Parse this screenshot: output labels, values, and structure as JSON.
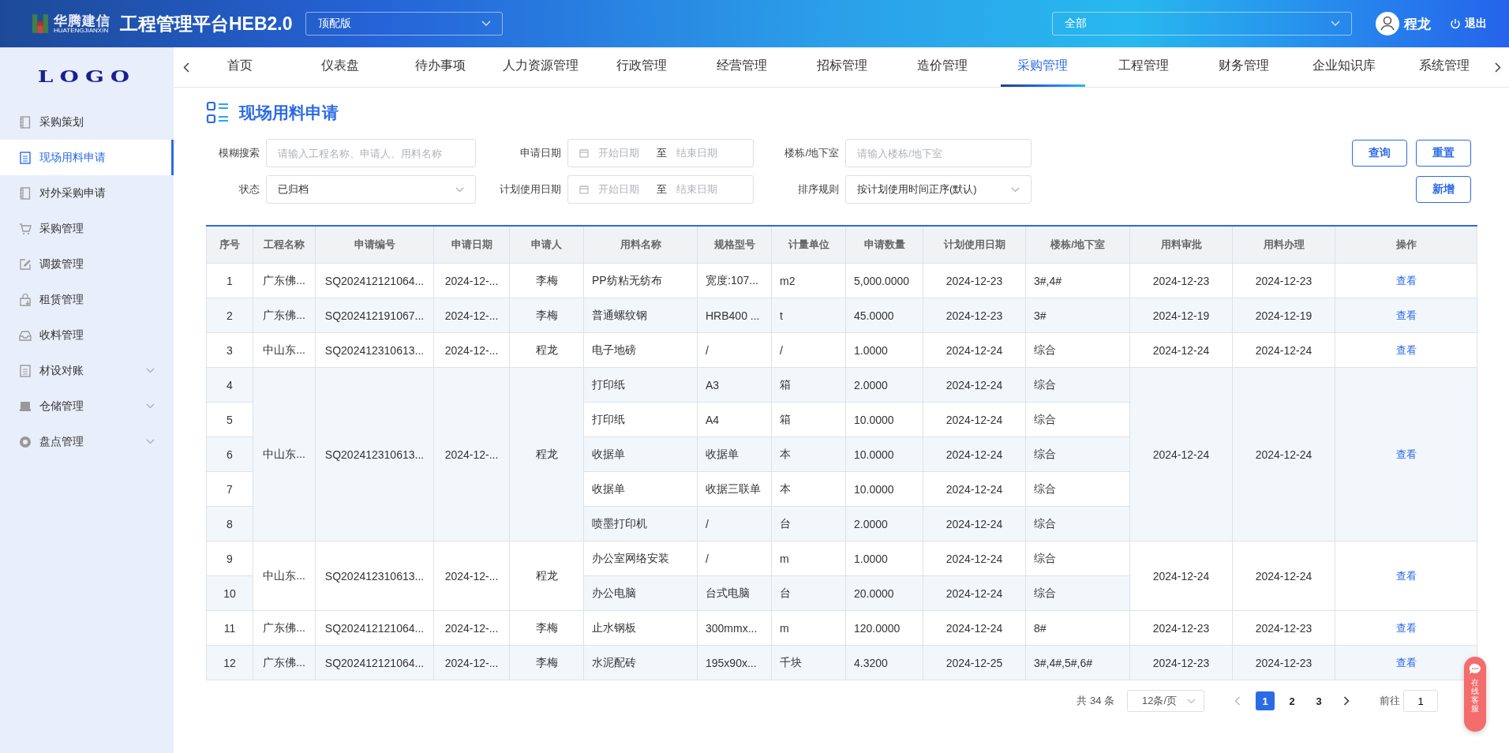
{
  "header": {
    "brand": {
      "name": "华腾建信",
      "latin": "HUATENGJIANXIN"
    },
    "title": "工程管理平台HEB2.0",
    "edition_select": {
      "value": "顶配版"
    },
    "scope_select": {
      "value": "全部"
    },
    "user": {
      "name": "程龙"
    },
    "logout": "退出"
  },
  "sidebar": {
    "logo": "LOGO",
    "items": [
      {
        "label": "采购策划",
        "kind": "notebook",
        "selected": false,
        "expandable": false
      },
      {
        "label": "现场用料申请",
        "kind": "document",
        "selected": true,
        "expandable": false
      },
      {
        "label": "对外采购申请",
        "kind": "notebook",
        "selected": false,
        "expandable": false
      },
      {
        "label": "采购管理",
        "kind": "cart",
        "selected": false,
        "expandable": false
      },
      {
        "label": "调拨管理",
        "kind": "edit",
        "selected": false,
        "expandable": false
      },
      {
        "label": "租赁管理",
        "kind": "bag",
        "selected": false,
        "expandable": false
      },
      {
        "label": "收料管理",
        "kind": "inbox",
        "selected": false,
        "expandable": false
      },
      {
        "label": "材设对账",
        "kind": "document",
        "selected": false,
        "expandable": true
      },
      {
        "label": "仓储管理",
        "kind": "shelf",
        "selected": false,
        "expandable": true
      },
      {
        "label": "盘点管理",
        "kind": "ring",
        "selected": false,
        "expandable": true
      }
    ]
  },
  "nav_tabs": [
    {
      "label": "首页",
      "selected": false
    },
    {
      "label": "仪表盘",
      "selected": false
    },
    {
      "label": "待办事项",
      "selected": false
    },
    {
      "label": "人力资源管理",
      "selected": false
    },
    {
      "label": "行政管理",
      "selected": false
    },
    {
      "label": "经营管理",
      "selected": false
    },
    {
      "label": "招标管理",
      "selected": false
    },
    {
      "label": "造价管理",
      "selected": false
    },
    {
      "label": "采购管理",
      "selected": true
    },
    {
      "label": "工程管理",
      "selected": false
    },
    {
      "label": "财务管理",
      "selected": false
    },
    {
      "label": "企业知识库",
      "selected": false
    },
    {
      "label": "系统管理",
      "selected": false
    }
  ],
  "page_title": "现场用料申请",
  "filter_rows": [
    {
      "fields": [
        {
          "label": "模糊搜索",
          "kind": "text",
          "placeholder": "请输入工程名称、申请人、用料名称"
        },
        {
          "label": "申请日期",
          "kind": "daterange",
          "start_placeholder": "开始日期",
          "separator": "至",
          "end_placeholder": "结束日期"
        },
        {
          "label": "楼栋/地下室",
          "kind": "text",
          "placeholder": "请输入楼栋/地下室"
        }
      ],
      "buttons": [
        "查询",
        "重置"
      ]
    },
    {
      "fields": [
        {
          "label": "状态",
          "kind": "select",
          "value": "已归档"
        },
        {
          "label": "计划使用日期",
          "kind": "daterange",
          "start_placeholder": "开始日期",
          "separator": "至",
          "end_placeholder": "结束日期"
        },
        {
          "label": "排序规则",
          "kind": "select",
          "value": "按计划使用时间正序(默认)"
        }
      ],
      "buttons": [
        "新增"
      ]
    }
  ],
  "table": {
    "columns": [
      "序号",
      "工程名称",
      "申请编号",
      "申请日期",
      "申请人",
      "用料名称",
      "规格型号",
      "计量单位",
      "申请数量",
      "计划使用日期",
      "楼栋/地下室",
      "用料审批",
      "用料办理",
      "操作"
    ],
    "groups": [
      {
        "project": "广东佛...",
        "code": "SQ202412121064...",
        "date": "2024-12-...",
        "applicant": "李梅",
        "approval": "2024-12-23",
        "handling": "2024-12-23",
        "action": "查看",
        "items": [
          {
            "no": "1",
            "material": "PP纺粘无纺布",
            "spec": "宽度:107...",
            "unit": "m2",
            "qty": "5,000.0000",
            "plan_date": "2024-12-23",
            "building": "3#,4#"
          }
        ]
      },
      {
        "project": "广东佛...",
        "code": "SQ202412191067...",
        "date": "2024-12-...",
        "applicant": "李梅",
        "approval": "2024-12-19",
        "handling": "2024-12-19",
        "action": "查看",
        "items": [
          {
            "no": "2",
            "material": "普通螺纹钢",
            "spec": "HRB400 ...",
            "unit": "t",
            "qty": "45.0000",
            "plan_date": "2024-12-23",
            "building": "3#"
          }
        ]
      },
      {
        "project": "中山东...",
        "code": "SQ202412310613...",
        "date": "2024-12-...",
        "applicant": "程龙",
        "approval": "2024-12-24",
        "handling": "2024-12-24",
        "action": "查看",
        "items": [
          {
            "no": "3",
            "material": "电子地磅",
            "spec": "/",
            "unit": "/",
            "qty": "1.0000",
            "plan_date": "2024-12-24",
            "building": "综合"
          }
        ]
      },
      {
        "project": "中山东...",
        "code": "SQ202412310613...",
        "date": "2024-12-...",
        "applicant": "程龙",
        "approval": "2024-12-24",
        "handling": "2024-12-24",
        "action": "查看",
        "items": [
          {
            "no": "4",
            "material": "打印纸",
            "spec": "A3",
            "unit": "箱",
            "qty": "2.0000",
            "plan_date": "2024-12-24",
            "building": "综合"
          },
          {
            "no": "5",
            "material": "打印纸",
            "spec": "A4",
            "unit": "箱",
            "qty": "10.0000",
            "plan_date": "2024-12-24",
            "building": "综合"
          },
          {
            "no": "6",
            "material": "收据单",
            "spec": "收据单",
            "unit": "本",
            "qty": "10.0000",
            "plan_date": "2024-12-24",
            "building": "综合"
          },
          {
            "no": "7",
            "material": "收据单",
            "spec": "收据三联单",
            "unit": "本",
            "qty": "10.0000",
            "plan_date": "2024-12-24",
            "building": "综合"
          },
          {
            "no": "8",
            "material": "喷墨打印机",
            "spec": "/",
            "unit": "台",
            "qty": "2.0000",
            "plan_date": "2024-12-24",
            "building": "综合"
          }
        ]
      },
      {
        "project": "中山东...",
        "code": "SQ202412310613...",
        "date": "2024-12-...",
        "applicant": "程龙",
        "approval": "2024-12-24",
        "handling": "2024-12-24",
        "action": "查看",
        "items": [
          {
            "no": "9",
            "material": "办公室网络安装",
            "spec": "/",
            "unit": "m",
            "qty": "1.0000",
            "plan_date": "2024-12-24",
            "building": "综合"
          },
          {
            "no": "10",
            "material": "办公电脑",
            "spec": "台式电脑",
            "unit": "台",
            "qty": "20.0000",
            "plan_date": "2024-12-24",
            "building": "综合"
          }
        ]
      },
      {
        "project": "广东佛...",
        "code": "SQ202412121064...",
        "date": "2024-12-...",
        "applicant": "李梅",
        "approval": "2024-12-23",
        "handling": "2024-12-23",
        "action": "查看",
        "items": [
          {
            "no": "11",
            "material": "止水钢板",
            "spec": "300mmx...",
            "unit": "m",
            "qty": "120.0000",
            "plan_date": "2024-12-24",
            "building": "8#"
          }
        ]
      },
      {
        "project": "广东佛...",
        "code": "SQ202412121064...",
        "date": "2024-12-...",
        "applicant": "李梅",
        "approval": "2024-12-23",
        "handling": "2024-12-23",
        "action": "查看",
        "items": [
          {
            "no": "12",
            "material": "水泥配砖",
            "spec": "195x90x...",
            "unit": "千块",
            "qty": "4.3200",
            "plan_date": "2024-12-25",
            "building": "3#,4#,5#,6#"
          }
        ]
      }
    ]
  },
  "pagination": {
    "total": "共 34 条",
    "page_size": "12条/页",
    "pages": [
      {
        "label": "1",
        "selected": true
      },
      {
        "label": "2",
        "selected": false
      },
      {
        "label": "3",
        "selected": false
      }
    ],
    "goto_label": "前往",
    "goto_value": "1"
  },
  "chat_button": {
    "label": "在线客服"
  }
}
